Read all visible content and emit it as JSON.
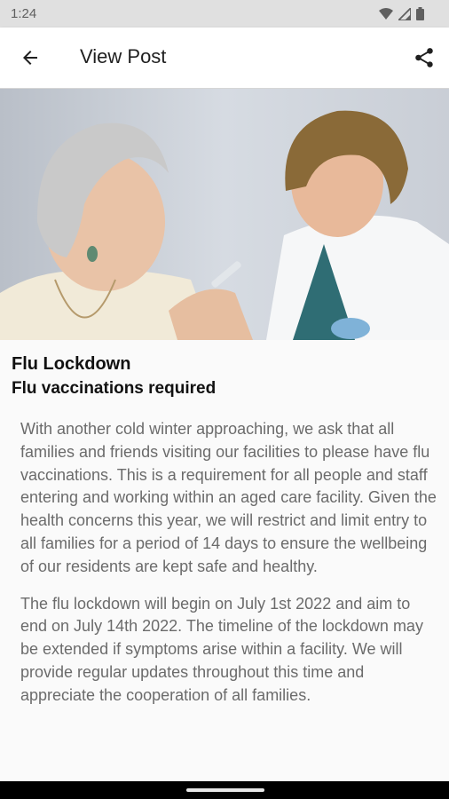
{
  "status_bar": {
    "time": "1:24",
    "icons": [
      "wifi-icon",
      "signal-icon",
      "battery-icon"
    ]
  },
  "app_bar": {
    "title": "View Post",
    "back_icon": "arrow-back-icon",
    "share_icon": "share-icon"
  },
  "post": {
    "title": "Flu Lockdown",
    "subtitle": "Flu vaccinations required",
    "paragraphs": [
      "With another cold winter approaching, we ask that all families and friends visiting our facilities to please have flu vaccinations. This is a requirement for all people and staff entering and working within an aged care facility. Given the health concerns this year, we will restrict and limit entry to all families for a period of 14 days to ensure the wellbeing of our residents are kept safe and healthy.",
      "The flu lockdown will begin on July 1st 2022 and aim to end on July 14th 2022. The timeline of the lockdown may be extended if symptoms arise within a facility. We will provide regular updates throughout this time and appreciate the cooperation of all families."
    ]
  },
  "colors": {
    "status_bar_bg": "#e0e0e0",
    "app_bar_bg": "#ffffff",
    "page_bg": "#fafafa",
    "body_text": "#6b6b6b",
    "title_text": "#111111"
  }
}
